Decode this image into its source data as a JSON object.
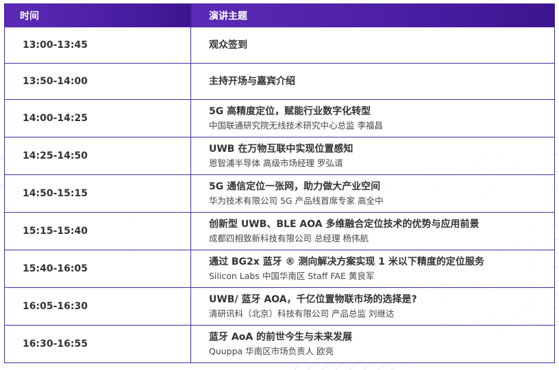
{
  "header": {
    "time": "时间",
    "topic": "演讲主题"
  },
  "rows": [
    {
      "time": "13:00-13:45",
      "title": "观众签到",
      "speaker": ""
    },
    {
      "time": "13:50-14:00",
      "title": "主持开场与嘉宾介绍",
      "speaker": ""
    },
    {
      "time": "14:00-14:25",
      "title": "5G 高精度定位，赋能行业数字化转型",
      "speaker": "中国联通研究院无线技术研究中心总监  李福昌"
    },
    {
      "time": "14:25-14:50",
      "title": "UWB 在万物互联中实现位置感知",
      "speaker": "恩智浦半导体 高级市场经理  罗弘谞"
    },
    {
      "time": "14:50-15:15",
      "title": "5G 通信定位一张网，助力做大产业空间",
      "speaker": "华为技术有限公司 5G 产品线首席专家 高全中"
    },
    {
      "time": "15:15-15:40",
      "title": "创新型 UWB、BLE AOA 多维融合定位技术的优势与应用前景",
      "speaker": "成都四相致新科技有限公司 总经理 杨伟航"
    },
    {
      "time": "15:40-16:05",
      "title": "通过 BG2x 蓝牙 ® 测向解决方案实现 1 米以下精度的定位服务",
      "speaker": "Silicon Labs 中国华南区 Staff FAE 黄良军"
    },
    {
      "time": "16:05-16:30",
      "title": "UWB/ 蓝牙 AOA，千亿位置物联市场的选择是?",
      "speaker": "清研讯科（北京）科技有限公司  产品总监  刘继达"
    },
    {
      "time": "16:30-16:55",
      "title": "蓝牙 AoA 的前世今生与未来发展",
      "speaker": "Quuppa  华南区市场负责人 欧亮"
    }
  ],
  "colors": {
    "header_bg": "#4c1fa5",
    "border": "#3e2f9a",
    "text": "#333333"
  }
}
